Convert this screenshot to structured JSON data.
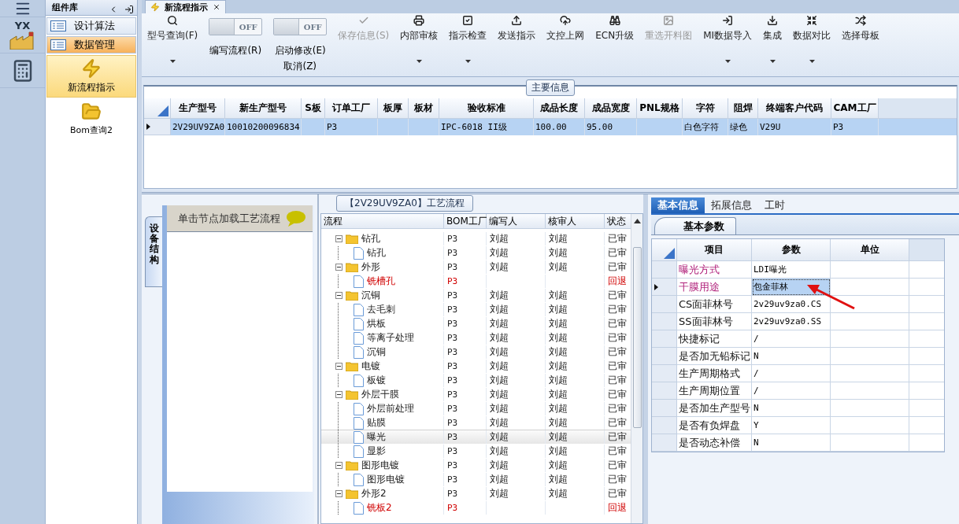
{
  "rail": {
    "logo": "YX"
  },
  "nav": {
    "title": "组件库",
    "items": [
      {
        "label": "设计算法",
        "selected": false
      },
      {
        "label": "数据管理",
        "selected": true
      }
    ],
    "tiles": [
      {
        "label": "新流程指示",
        "selected": true
      },
      {
        "label": "Bom查询2",
        "selected": false
      }
    ]
  },
  "tab": {
    "label": "新流程指示"
  },
  "toolbar": [
    {
      "kind": "button",
      "label": "型号查询(F)",
      "dropdown": true,
      "disabled": false
    },
    {
      "kind": "switch",
      "switch_text": "OFF",
      "on": false,
      "label": "编写流程(R)"
    },
    {
      "kind": "switch",
      "switch_text": "OFF",
      "on": false,
      "label": "启动修改(E)",
      "sublabel": "取消(Z)"
    },
    {
      "kind": "button",
      "label": "保存信息(S)",
      "dropdown": false,
      "disabled": true
    },
    {
      "kind": "button",
      "label": "内部审核",
      "dropdown": true,
      "disabled": false
    },
    {
      "kind": "button",
      "label": "指示检查",
      "dropdown": true,
      "disabled": false
    },
    {
      "kind": "button",
      "label": "发送指示",
      "dropdown": false,
      "disabled": false
    },
    {
      "kind": "button",
      "label": "文控上网",
      "dropdown": false,
      "disabled": false
    },
    {
      "kind": "button",
      "label": "ECN升级",
      "dropdown": false,
      "disabled": false
    },
    {
      "kind": "button",
      "label": "重选开料图",
      "dropdown": false,
      "disabled": true
    },
    {
      "kind": "button",
      "label": "MI数据导入",
      "dropdown": true,
      "disabled": false
    },
    {
      "kind": "button",
      "label": "集成",
      "dropdown": true,
      "disabled": false
    },
    {
      "kind": "button",
      "label": "数据对比",
      "dropdown": true,
      "disabled": false
    },
    {
      "kind": "button",
      "label": "选择母板",
      "dropdown": false,
      "disabled": false
    }
  ],
  "main_info": {
    "title": "主要信息",
    "columns": [
      "生产型号",
      "新生产型号",
      "S板",
      "订单工厂",
      "板厚",
      "板材",
      "验收标准",
      "成品长度",
      "成品宽度",
      "PNL规格",
      "字符",
      "阻焊",
      "终端客户代码",
      "CAM工厂"
    ],
    "rows": [
      {
        "selected": true,
        "cells": [
          "2V29UV9ZA0",
          "10010200096834",
          "",
          "P3",
          "",
          "",
          "IPC-6018 II级",
          "100.00",
          "95.00",
          "",
          "白色字符",
          "绿色",
          "V29U",
          "P3"
        ]
      }
    ]
  },
  "structure_panel": {
    "tab": "设备结构",
    "hint": "单击节点加载工艺流程"
  },
  "process_flow": {
    "title": "【2V29UV9ZA0】工艺流程",
    "columns": [
      "流程",
      "BOM工厂",
      "编写人",
      "核审人",
      "状态"
    ],
    "nodes": [
      {
        "label": "钻孔",
        "bom": "P3",
        "writer": "刘超",
        "reviewer": "刘超",
        "status": "已审",
        "returned": false,
        "selected": false,
        "expanded": true,
        "children": [
          {
            "label": "钻孔",
            "bom": "P3",
            "writer": "刘超",
            "reviewer": "刘超",
            "status": "已审",
            "returned": false,
            "selected": false
          }
        ]
      },
      {
        "label": "外形",
        "bom": "P3",
        "writer": "刘超",
        "reviewer": "刘超",
        "status": "已审",
        "returned": false,
        "selected": false,
        "expanded": true,
        "children": [
          {
            "label": "铣槽孔",
            "bom": "P3",
            "status": "回退",
            "returned": true,
            "selected": false
          }
        ]
      },
      {
        "label": "沉铜",
        "bom": "P3",
        "writer": "刘超",
        "reviewer": "刘超",
        "status": "已审",
        "returned": false,
        "selected": false,
        "expanded": true,
        "children": [
          {
            "label": "去毛刺",
            "bom": "P3",
            "writer": "刘超",
            "reviewer": "刘超",
            "status": "已审",
            "returned": false,
            "selected": false
          },
          {
            "label": "烘板",
            "bom": "P3",
            "writer": "刘超",
            "reviewer": "刘超",
            "status": "已审",
            "returned": false,
            "selected": false
          },
          {
            "label": "等离子处理",
            "bom": "P3",
            "writer": "刘超",
            "reviewer": "刘超",
            "status": "已审",
            "returned": false,
            "selected": false
          },
          {
            "label": "沉铜",
            "bom": "P3",
            "writer": "刘超",
            "reviewer": "刘超",
            "status": "已审",
            "returned": false,
            "selected": false
          }
        ]
      },
      {
        "label": "电镀",
        "bom": "P3",
        "writer": "刘超",
        "reviewer": "刘超",
        "status": "已审",
        "returned": false,
        "selected": false,
        "expanded": true,
        "children": [
          {
            "label": "板镀",
            "bom": "P3",
            "writer": "刘超",
            "reviewer": "刘超",
            "status": "已审",
            "returned": false,
            "selected": false
          }
        ]
      },
      {
        "label": "外层干膜",
        "bom": "P3",
        "writer": "刘超",
        "reviewer": "刘超",
        "status": "已审",
        "returned": false,
        "selected": false,
        "expanded": true,
        "children": [
          {
            "label": "外层前处理",
            "bom": "P3",
            "writer": "刘超",
            "reviewer": "刘超",
            "status": "已审",
            "returned": false,
            "selected": false
          },
          {
            "label": "贴膜",
            "bom": "P3",
            "writer": "刘超",
            "reviewer": "刘超",
            "status": "已审",
            "returned": false,
            "selected": false
          },
          {
            "label": "曝光",
            "bom": "P3",
            "writer": "刘超",
            "reviewer": "刘超",
            "status": "已审",
            "returned": false,
            "selected": true
          },
          {
            "label": "显影",
            "bom": "P3",
            "writer": "刘超",
            "reviewer": "刘超",
            "status": "已审",
            "returned": false,
            "selected": false
          }
        ]
      },
      {
        "label": "图形电镀",
        "bom": "P3",
        "writer": "刘超",
        "reviewer": "刘超",
        "status": "已审",
        "returned": false,
        "selected": false,
        "expanded": true,
        "children": [
          {
            "label": "图形电镀",
            "bom": "P3",
            "writer": "刘超",
            "reviewer": "刘超",
            "status": "已审",
            "returned": false,
            "selected": false
          }
        ]
      },
      {
        "label": "外形2",
        "bom": "P3",
        "writer": "刘超",
        "reviewer": "刘超",
        "status": "已审",
        "returned": false,
        "selected": false,
        "expanded": true,
        "children": [
          {
            "label": "铣板2",
            "bom": "P3",
            "status": "回退",
            "returned": true,
            "selected": false
          }
        ]
      }
    ]
  },
  "detail": {
    "tabs": [
      {
        "label": "基本信息",
        "selected": true
      },
      {
        "label": "拓展信息",
        "selected": false
      },
      {
        "label": "工时",
        "selected": false
      }
    ],
    "subtab": "基本参数",
    "columns": [
      "项目",
      "参数",
      "单位"
    ],
    "rows": [
      {
        "item": "曝光方式",
        "value": "LDI曝光",
        "color": "#b0207a",
        "selected": false
      },
      {
        "item": "干膜用途",
        "value": "包金菲林",
        "color": "#b0207a",
        "selected": true
      },
      {
        "item": "CS面菲林号",
        "value": "2v29uv9za0.CS",
        "selected": false
      },
      {
        "item": "SS面菲林号",
        "value": "2v29uv9za0.SS",
        "selected": false
      },
      {
        "item": "快捷标记",
        "value": "/",
        "selected": false
      },
      {
        "item": "是否加无铅标记",
        "value": "N",
        "selected": false
      },
      {
        "item": "生产周期格式",
        "value": "/",
        "selected": false
      },
      {
        "item": "生产周期位置",
        "value": "/",
        "selected": false
      },
      {
        "item": "是否加生产型号",
        "value": "N",
        "selected": false
      },
      {
        "item": "是否有负焊盘",
        "value": "Y",
        "selected": false
      },
      {
        "item": "是否动态补偿",
        "value": "N",
        "selected": false
      }
    ]
  }
}
